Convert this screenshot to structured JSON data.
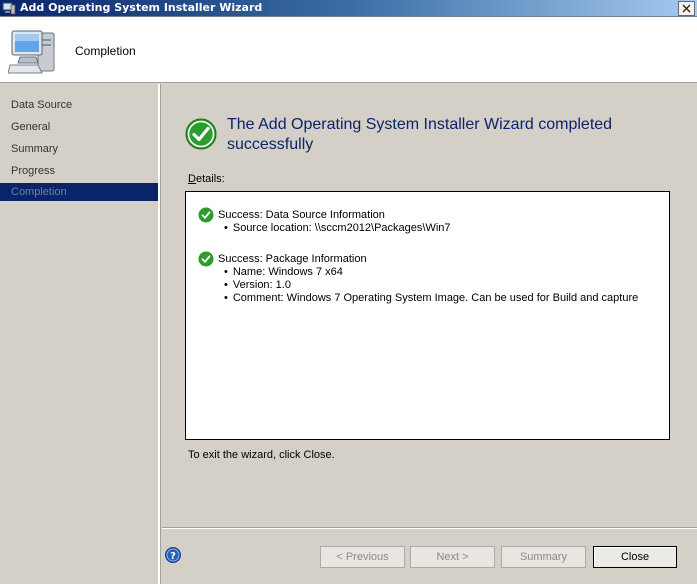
{
  "window": {
    "title": "Add Operating System Installer Wizard"
  },
  "header": {
    "title": "Completion"
  },
  "nav": {
    "items": [
      {
        "label": "Data Source"
      },
      {
        "label": "General"
      },
      {
        "label": "Summary"
      },
      {
        "label": "Progress"
      },
      {
        "label": "Completion",
        "active": true
      }
    ]
  },
  "main": {
    "title": "The Add Operating System Installer Wizard completed successfully",
    "details_label": "Details:",
    "sections": [
      {
        "heading": "Success: Data Source Information",
        "items": [
          "Source location: \\\\sccm2012\\Packages\\Win7"
        ]
      },
      {
        "heading": "Success: Package Information",
        "items": [
          "Name: Windows 7 x64",
          "Version: 1.0",
          "Comment: Windows 7 Operating System Image. Can be used for Build and capture"
        ]
      }
    ],
    "exit_text": "To exit the wizard, click Close."
  },
  "buttons": {
    "previous": "< Previous",
    "next": "Next >",
    "summary": "Summary",
    "close": "Close"
  },
  "colors": {
    "accent": "#0a246a",
    "success": "#2e9b2e"
  }
}
